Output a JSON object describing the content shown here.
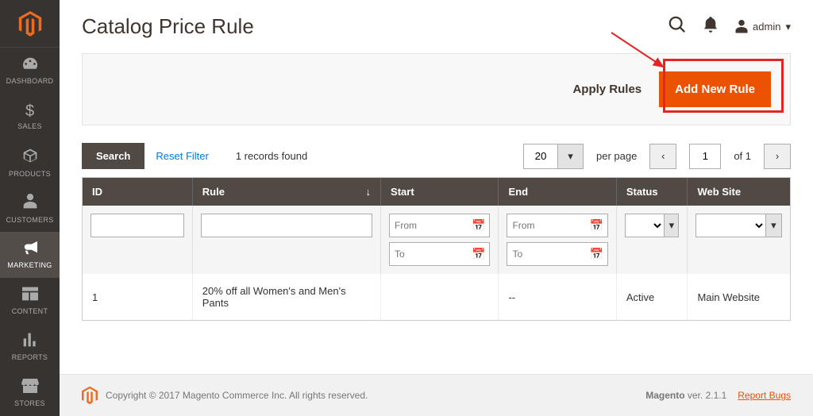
{
  "header": {
    "title": "Catalog Price Rule",
    "user": "admin"
  },
  "sidebar": {
    "items": [
      {
        "id": "dashboard",
        "label": "DASHBOARD"
      },
      {
        "id": "sales",
        "label": "SALES"
      },
      {
        "id": "products",
        "label": "PRODUCTS"
      },
      {
        "id": "customers",
        "label": "CUSTOMERS"
      },
      {
        "id": "marketing",
        "label": "MARKETING"
      },
      {
        "id": "content",
        "label": "CONTENT"
      },
      {
        "id": "reports",
        "label": "REPORTS"
      },
      {
        "id": "stores",
        "label": "STORES"
      }
    ]
  },
  "actions": {
    "apply_rules": "Apply Rules",
    "add_new_rule": "Add New Rule"
  },
  "grid_controls": {
    "search": "Search",
    "reset_filter": "Reset Filter",
    "records_found": "1 records found",
    "per_page_value": "20",
    "per_page_label": "per page",
    "current_page": "1",
    "of_label": "of 1"
  },
  "columns": {
    "id": "ID",
    "rule": "Rule",
    "start": "Start",
    "end": "End",
    "status": "Status",
    "website": "Web Site"
  },
  "filters": {
    "from_placeholder": "From",
    "to_placeholder": "To"
  },
  "rows": [
    {
      "id": "1",
      "rule": "20% off all Women's and Men's Pants",
      "start": "",
      "end": "--",
      "status": "Active",
      "website": "Main Website"
    }
  ],
  "footer": {
    "copyright": "Copyright © 2017 Magento Commerce Inc. All rights reserved.",
    "version_label": "Magento",
    "version": " ver. 2.1.1",
    "report_bugs": "Report Bugs"
  }
}
